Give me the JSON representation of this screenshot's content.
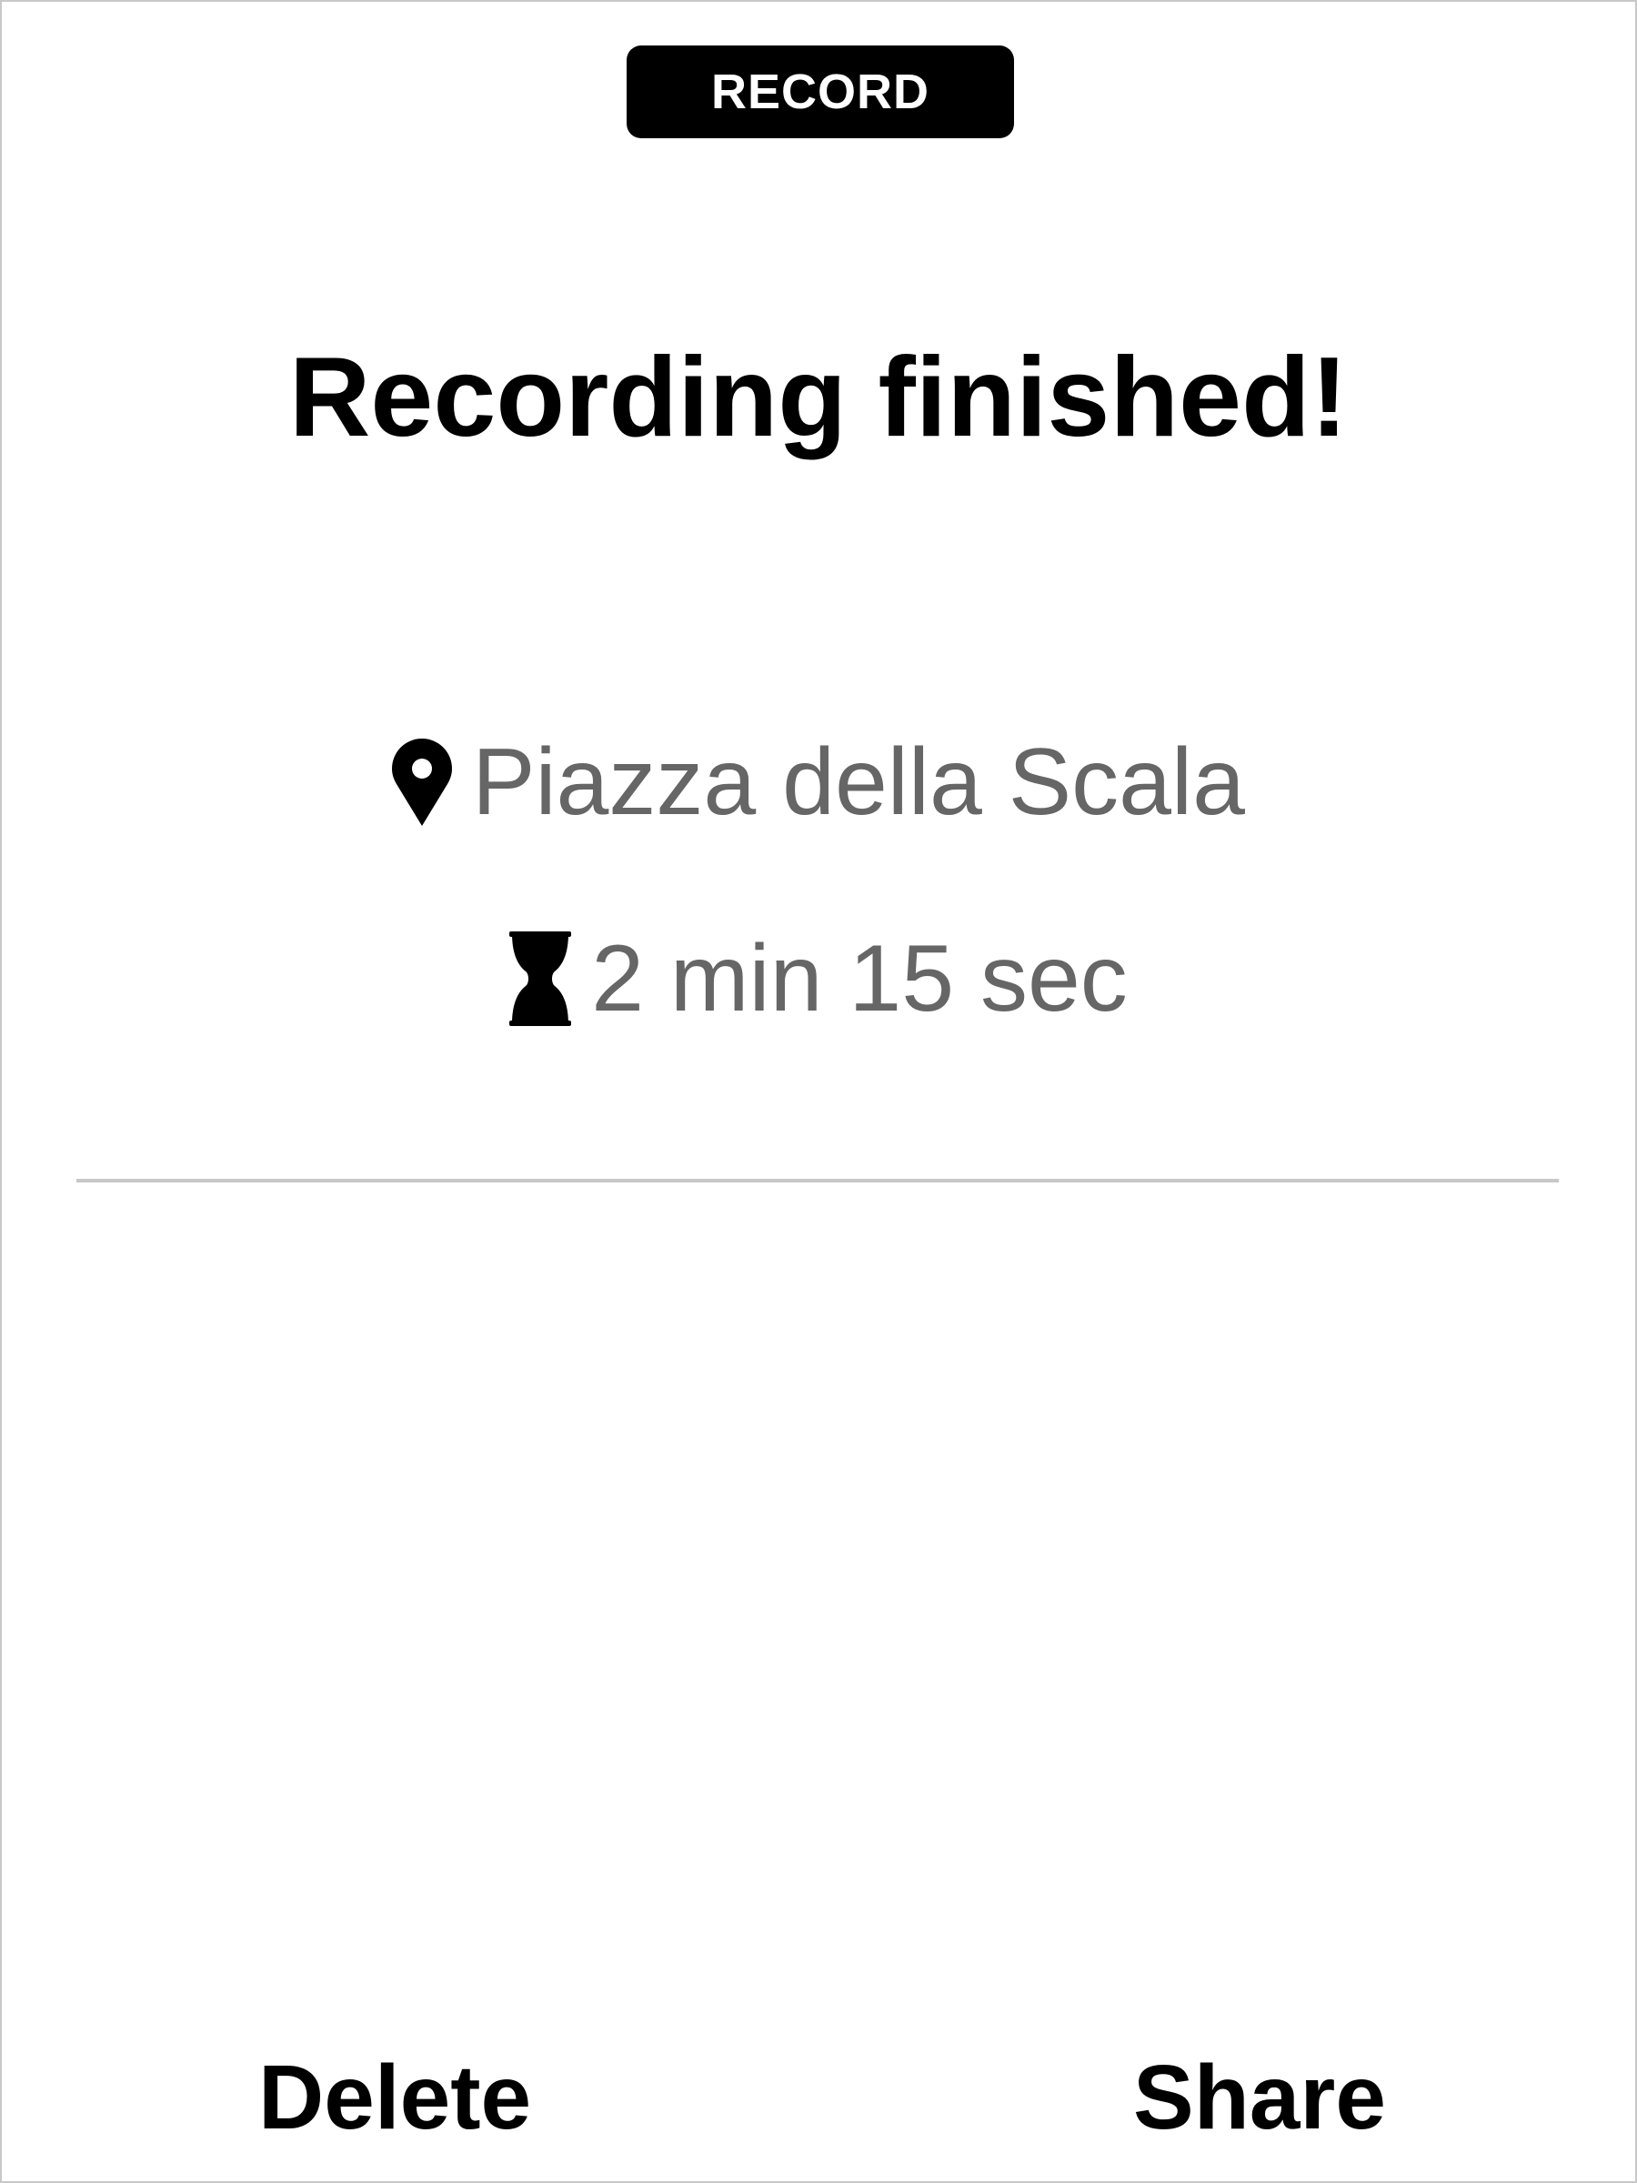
{
  "header": {
    "mode_label": "RECORD"
  },
  "main": {
    "title": "Recording finished!",
    "location": {
      "icon": "map-pin-icon",
      "text": "Piazza della Scala"
    },
    "duration": {
      "icon": "hourglass-icon",
      "text": "2 min 15 sec"
    }
  },
  "actions": {
    "delete_label": "Delete",
    "share_label": "Share"
  },
  "colors": {
    "primary_text": "#000000",
    "secondary_text": "#666666",
    "divider": "#c8c8c8",
    "pill_background": "#000000",
    "background": "#ffffff"
  }
}
